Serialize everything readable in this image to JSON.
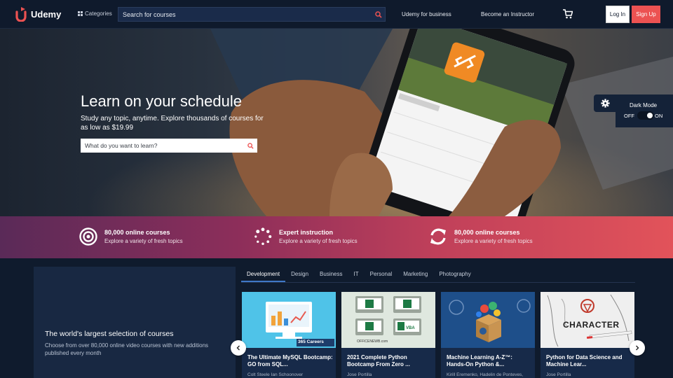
{
  "nav": {
    "brand": "Udemy",
    "categories": "Categories",
    "search_placeholder": "Search for courses",
    "business": "Udemy for business",
    "instructor": "Become an Instructor",
    "login": "Log In",
    "signup": "Sign Up"
  },
  "hero": {
    "title": "Learn on your schedule",
    "subtitle": "Study any topic, anytime. Explore thousands of courses for as low as $19.99",
    "search_placeholder": "What do you want to learn?"
  },
  "dark_mode": {
    "label": "Dark Mode",
    "off": "OFF",
    "on": "ON",
    "enabled": true
  },
  "features": [
    {
      "icon": "target-icon",
      "title": "80,000 online courses",
      "subtitle": "Explore a variety of fresh topics"
    },
    {
      "icon": "loading-dots-icon",
      "title": "Expert instruction",
      "subtitle": "Explore a variety of fresh topics"
    },
    {
      "icon": "refresh-icon",
      "title": "80,000 online courses",
      "subtitle": "Explore a variety of fresh topics"
    }
  ],
  "promo": {
    "title": "The world's largest selection of courses",
    "subtitle": "Choose from over 80,000 online video courses with new additions published every month"
  },
  "tabs": [
    "Development",
    "Design",
    "Business",
    "IT",
    "Personal",
    "Marketing",
    "Photography"
  ],
  "active_tab": "Development",
  "courses": [
    {
      "title": "The Ultimate MySQL Bootcamp: GO from SQL...",
      "author": "Colt Steele Ian Schoonover",
      "badge": "365 Careers"
    },
    {
      "title": "2021 Complete Python Bootcamp From Zero ...",
      "author": "Jose Portilla",
      "badge": "OFFICENEWB.com"
    },
    {
      "title": "Machine Learning A-Z™: Hands-On Python &...",
      "author": "Kirill Eremenko, Hadelin de Ponteves,",
      "badge": ""
    },
    {
      "title": "Python for Data Science and Machine Lear...",
      "author": "Jose Portilla",
      "badge": "CHARACTER"
    }
  ],
  "colors": {
    "brand_red": "#ec5252",
    "nav_bg": "#0f1a2c",
    "card_bg": "#172a49",
    "accent_blue": "#3f78c6"
  }
}
